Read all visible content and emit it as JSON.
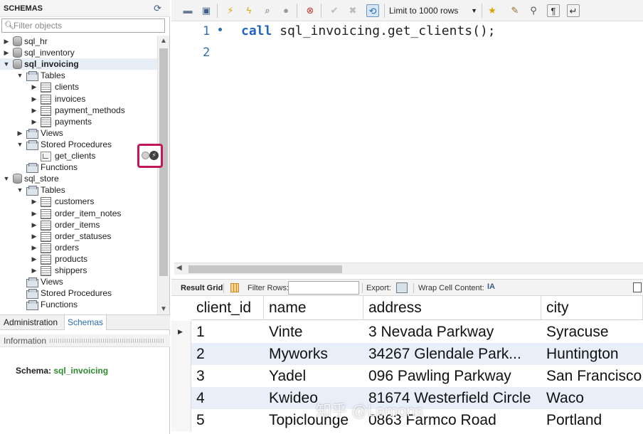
{
  "sidebar": {
    "title": "SCHEMAS",
    "filter_placeholder": "Filter objects",
    "tree": [
      {
        "label": "sql_hr",
        "level": 0,
        "type": "schema",
        "toggle": "▶"
      },
      {
        "label": "sql_inventory",
        "level": 0,
        "type": "schema",
        "toggle": "▶"
      },
      {
        "label": "sql_invoicing",
        "level": 0,
        "type": "schema",
        "toggle": "▼",
        "bold": true,
        "selected": true
      },
      {
        "label": "Tables",
        "level": 1,
        "type": "folder",
        "toggle": "▼"
      },
      {
        "label": "clients",
        "level": 2,
        "type": "table",
        "toggle": "▶"
      },
      {
        "label": "invoices",
        "level": 2,
        "type": "table",
        "toggle": "▶"
      },
      {
        "label": "payment_methods",
        "level": 2,
        "type": "table",
        "toggle": "▶"
      },
      {
        "label": "payments",
        "level": 2,
        "type": "table",
        "toggle": "▶"
      },
      {
        "label": "Views",
        "level": 1,
        "type": "folder",
        "toggle": "▶"
      },
      {
        "label": "Stored Procedures",
        "level": 1,
        "type": "folder",
        "toggle": "▼"
      },
      {
        "label": "get_clients",
        "level": 2,
        "type": "procedure",
        "toggle": ""
      },
      {
        "label": "Functions",
        "level": 1,
        "type": "folder",
        "toggle": ""
      },
      {
        "label": "sql_store",
        "level": 0,
        "type": "schema",
        "toggle": "▼"
      },
      {
        "label": "Tables",
        "level": 1,
        "type": "folder",
        "toggle": "▼"
      },
      {
        "label": "customers",
        "level": 2,
        "type": "table",
        "toggle": "▶"
      },
      {
        "label": "order_item_notes",
        "level": 2,
        "type": "table",
        "toggle": "▶"
      },
      {
        "label": "order_items",
        "level": 2,
        "type": "table",
        "toggle": "▶"
      },
      {
        "label": "order_statuses",
        "level": 2,
        "type": "table",
        "toggle": "▶"
      },
      {
        "label": "orders",
        "level": 2,
        "type": "table",
        "toggle": "▶"
      },
      {
        "label": "products",
        "level": 2,
        "type": "table",
        "toggle": "▶"
      },
      {
        "label": "shippers",
        "level": 2,
        "type": "table",
        "toggle": "▶"
      },
      {
        "label": "Views",
        "level": 1,
        "type": "folder",
        "toggle": ""
      },
      {
        "label": "Stored Procedures",
        "level": 1,
        "type": "folder",
        "toggle": ""
      },
      {
        "label": "Functions",
        "level": 1,
        "type": "folder",
        "toggle": ""
      }
    ],
    "bottom_tabs": {
      "administration": "Administration",
      "schemas": "Schemas"
    },
    "info_title": "Information",
    "schema_label": "Schema:",
    "schema_value": "sql_invoicing",
    "highlight_color": "#c2185b"
  },
  "toolbar": {
    "limit_label": "Limit to 1000 rows"
  },
  "editor": {
    "lines": [
      {
        "number": "1",
        "keyword": "call",
        "rest": " sql_invoicing.get_clients();"
      },
      {
        "number": "2",
        "keyword": "",
        "rest": ""
      }
    ]
  },
  "result_bar": {
    "result_grid": "Result Grid",
    "filter_rows": "Filter Rows:",
    "export": "Export:",
    "wrap": "Wrap Cell Content:",
    "wrap_icon": "IA"
  },
  "grid": {
    "columns": [
      "client_id",
      "name",
      "address",
      "city"
    ],
    "rows": [
      [
        "1",
        "Vinte",
        "3 Nevada Parkway",
        "Syracuse"
      ],
      [
        "2",
        "Myworks",
        "34267 Glendale Park...",
        "Huntington"
      ],
      [
        "3",
        "Yadel",
        "096 Pawling Parkway",
        "San Francisco"
      ],
      [
        "4",
        "Kwideo",
        "81674 Westerfield Circle",
        "Waco"
      ],
      [
        "5",
        "Topiclounge",
        "0863 Farmco Road",
        "Portland"
      ]
    ]
  },
  "watermark": "知乎 @Lemons",
  "colors": {
    "accent": "#2a6db5",
    "keyword": "#2463c4",
    "alt_row": "#e8eff9"
  }
}
